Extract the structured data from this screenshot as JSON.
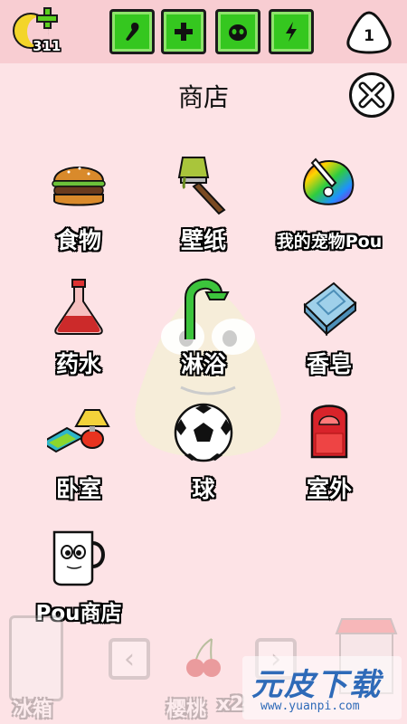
{
  "topbar": {
    "coins": "311",
    "status_icons": [
      "food-icon",
      "health-icon",
      "fun-icon",
      "energy-icon"
    ],
    "level": "1"
  },
  "title": "商店",
  "items": [
    {
      "label": "食物",
      "icon": "burger-icon"
    },
    {
      "label": "壁纸",
      "icon": "paintbrush-icon"
    },
    {
      "label": "我的宠物Pou",
      "icon": "palette-icon"
    },
    {
      "label": "药水",
      "icon": "potion-flask-icon"
    },
    {
      "label": "淋浴",
      "icon": "shower-icon"
    },
    {
      "label": "香皂",
      "icon": "soap-icon"
    },
    {
      "label": "卧室",
      "icon": "lamp-icon"
    },
    {
      "label": "球",
      "icon": "soccer-ball-icon"
    },
    {
      "label": "室外",
      "icon": "door-icon"
    },
    {
      "label": "Pou商店",
      "icon": "mug-icon"
    }
  ],
  "bottom": {
    "left_label": "冰箱",
    "center_label": "樱桃",
    "center_count": "x2"
  },
  "watermark": {
    "title": "元皮下载",
    "url": "www.yuanpi.com"
  },
  "colors": {
    "background": "#fde3e6",
    "topbar": "#f8cdd2",
    "status_green": "#35c71f",
    "coin": "#f3d52a",
    "watermark_blue": "#2e6ab8"
  }
}
